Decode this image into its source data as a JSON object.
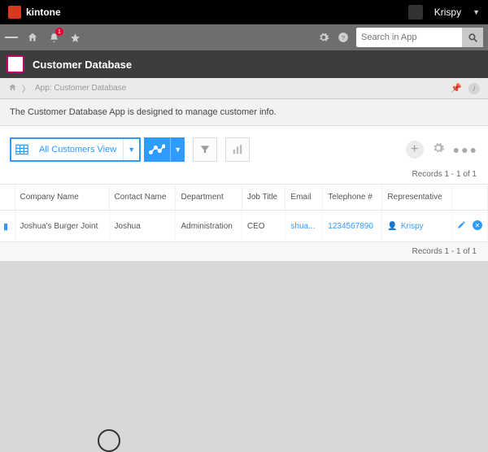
{
  "header": {
    "brand": "kintone",
    "user_name": "Krispy"
  },
  "nav": {
    "search_placeholder": "Search in App",
    "notification_count": "1"
  },
  "app": {
    "title": "Customer Database",
    "breadcrumb": "App: Customer Database",
    "description": "The Customer Database App is designed to manage customer info."
  },
  "view": {
    "name": "All Customers View",
    "records_text_top": "Records 1 - 1 of 1",
    "records_text_bottom": "Records 1 - 1 of 1"
  },
  "table": {
    "columns": [
      "Company Name",
      "Contact Name",
      "Department",
      "Job Title",
      "Email",
      "Telephone #",
      "Representative"
    ],
    "rows": [
      {
        "company": "Joshua's Burger Joint",
        "contact": "Joshua",
        "department": "Administration",
        "title": "CEO",
        "email": "shua...",
        "phone": "1234567890",
        "rep": "Krispy"
      }
    ]
  }
}
